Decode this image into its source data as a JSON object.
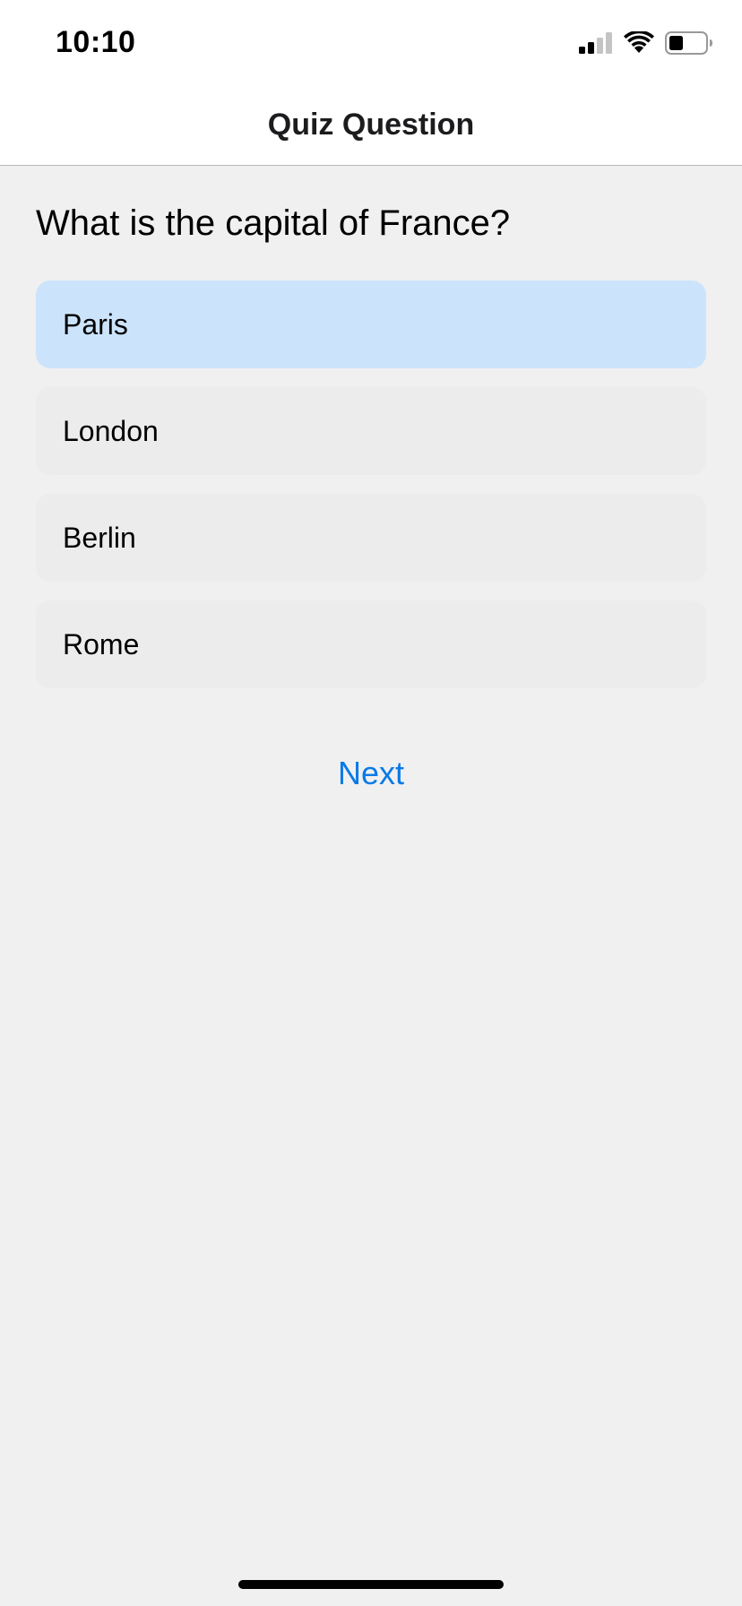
{
  "status_bar": {
    "time": "10:10",
    "icons": [
      "cellular-signal-icon",
      "wifi-icon",
      "battery-icon"
    ]
  },
  "nav": {
    "title": "Quiz Question"
  },
  "quiz": {
    "question": "What is the capital of France?",
    "options": [
      {
        "label": "Paris",
        "selected": true
      },
      {
        "label": "London",
        "selected": false
      },
      {
        "label": "Berlin",
        "selected": false
      },
      {
        "label": "Rome",
        "selected": false
      }
    ],
    "next_label": "Next"
  },
  "colors": {
    "background": "#f0f0f0",
    "option_bg": "#ececec",
    "selected_bg": "#cce4fb",
    "accent": "#0a7ae6"
  }
}
